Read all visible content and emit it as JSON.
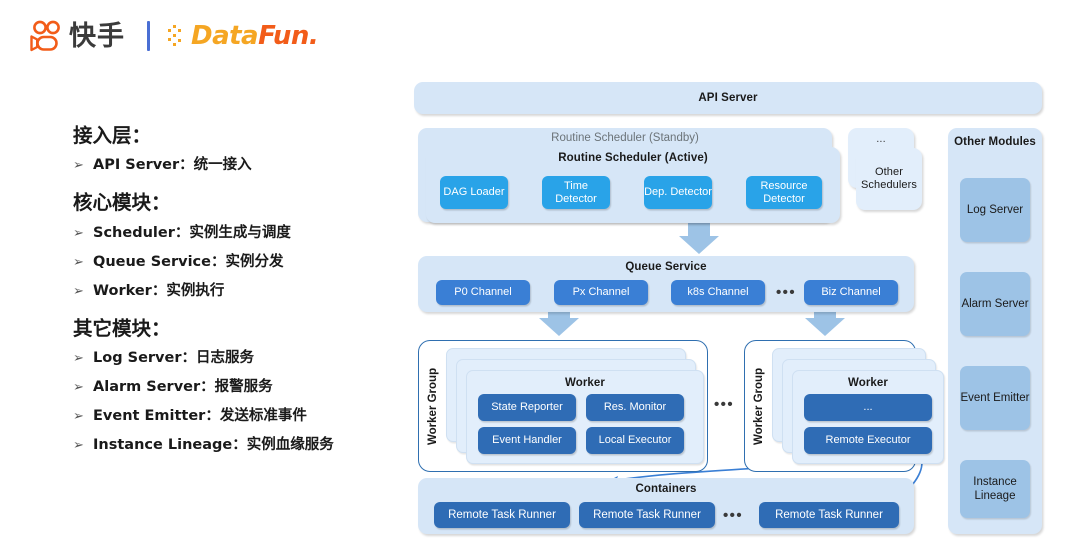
{
  "header": {
    "brand_primary": "快手",
    "brand_secondary_a": "Data",
    "brand_secondary_b": "Fun.",
    "colors": {
      "kuaishou_orange": "#f25c19",
      "datafun_yellow": "#f5a623",
      "datafun_orange": "#f25c19",
      "divider_blue": "#4a6fd4"
    }
  },
  "outline": {
    "sections": [
      {
        "title": "接入层：",
        "items": [
          "API Server：统一接入"
        ]
      },
      {
        "title": "核心模块：",
        "items": [
          "Scheduler：实例生成与调度",
          "Queue Service：实例分发",
          "Worker：实例执行"
        ]
      },
      {
        "title": "其它模块：",
        "items": [
          "Log Server：日志服务",
          "Alarm Server：报警服务",
          "Event Emitter：发送标准事件",
          "Instance Lineage：实例血缘服务"
        ]
      }
    ],
    "bullet_glyph": "➢"
  },
  "diagram": {
    "api_server": {
      "title": "API Server"
    },
    "scheduler": {
      "standby_title": "Routine Scheduler (Standby)",
      "active_title": "Routine Scheduler (Active)",
      "stages": [
        "DAG Loader",
        "Time Detector",
        "Dep. Detector",
        "Resource Detector"
      ]
    },
    "other_schedulers": {
      "ellipsis": "...",
      "label": "Other Schedulers"
    },
    "queue_service": {
      "title": "Queue Service",
      "channels": [
        "P0 Channel",
        "Px Channel",
        "k8s Channel",
        "Biz Channel"
      ],
      "ellipsis": "•••"
    },
    "worker_group_left": {
      "group_label": "Worker Group",
      "worker_title": "Worker",
      "components": [
        "State Reporter",
        "Res. Monitor",
        "Event Handler",
        "Local Executor"
      ]
    },
    "worker_group_right": {
      "group_label": "Worker Group",
      "worker_title": "Worker",
      "components": [
        "...",
        "Remote Executor"
      ]
    },
    "groups_ellipsis": "•••",
    "containers": {
      "title": "Containers",
      "runners": [
        "Remote Task Runner",
        "Remote Task Runner",
        "Remote Task Runner"
      ],
      "ellipsis": "•••"
    },
    "other_modules": {
      "title": "Other Modules",
      "modules": [
        "Log Server",
        "Alarm Server",
        "Event Emitter",
        "Instance Lineage"
      ]
    },
    "colors": {
      "panel_pale": "#d6e6f7",
      "panel_pale_light": "#e2eefb",
      "chip_light_blue": "#29a3e8",
      "chip_medium_blue": "#3a7fd5",
      "chip_dark_blue": "#2f6cb5",
      "chip_soft_blue": "#9dc3e6",
      "arrow_blue": "#9dc3e6",
      "outline_blue": "#2f6fb0"
    }
  }
}
